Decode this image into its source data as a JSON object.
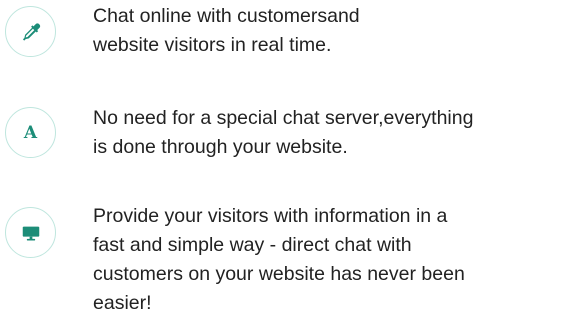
{
  "features": [
    {
      "icon": "dropper-icon",
      "lines": [
        "Chat online with customersand",
        "website visitors in real time."
      ]
    },
    {
      "icon": "font-letter-icon",
      "icon_letter": "A",
      "lines": [
        "No need for a special chat server,everything",
        "is done through your website."
      ]
    },
    {
      "icon": "monitor-icon",
      "lines": [
        "Provide your visitors with information in a",
        "fast and simple way - direct chat with",
        "customers on your website has never been",
        "easier!"
      ]
    }
  ],
  "colors": {
    "accent": "#1c8d78",
    "circle_border": "#bfe6de",
    "text": "#222222"
  }
}
